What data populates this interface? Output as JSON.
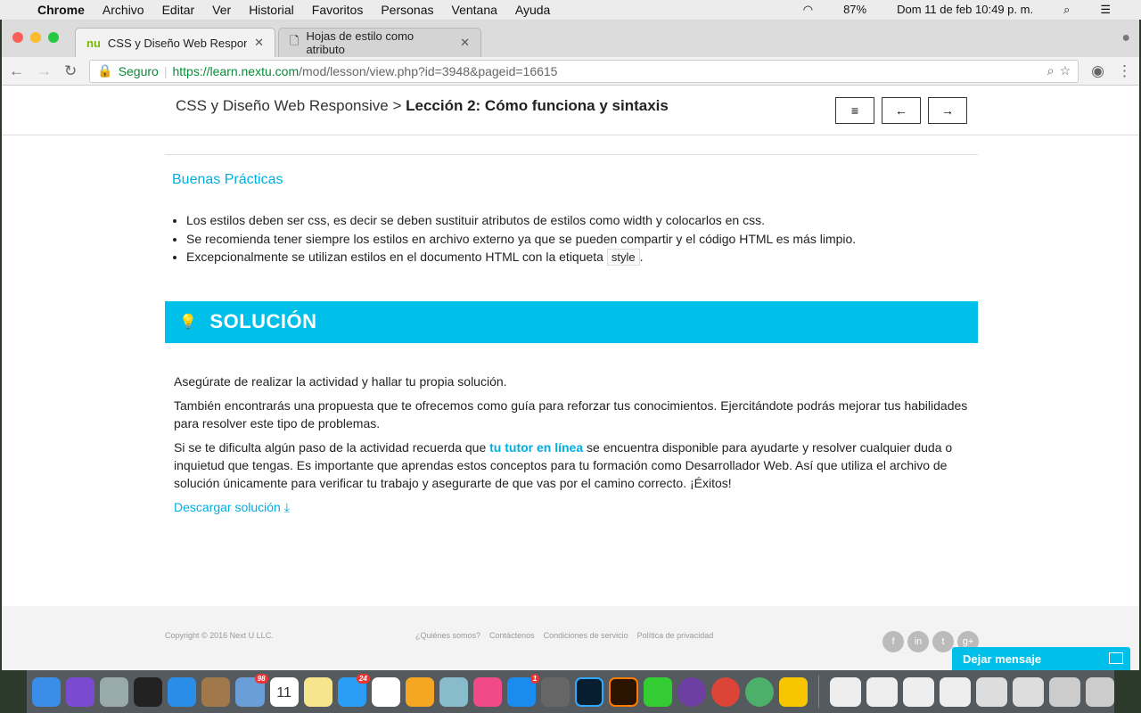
{
  "menubar": {
    "app": "Chrome",
    "items": [
      "Archivo",
      "Editar",
      "Ver",
      "Historial",
      "Favoritos",
      "Personas",
      "Ventana",
      "Ayuda"
    ],
    "battery": "87%",
    "datetime": "Dom 11 de feb  10:49 p. m."
  },
  "tabs": [
    {
      "title": "CSS y Diseño Web Responsive"
    },
    {
      "title": "Hojas de estilo como atributo"
    }
  ],
  "address": {
    "secure_label": "Seguro",
    "url_host": "https://learn.nextu.com",
    "url_path": "/mod/lesson/view.php?id=3948&pageid=16615"
  },
  "header": {
    "course": "CSS y Diseño Web Responsive >",
    "lesson": "Lección 2: Cómo funciona y sintaxis",
    "menu": "≡",
    "prev": "←",
    "next": "→"
  },
  "practices": {
    "title": "Buenas Prácticas",
    "items": [
      {
        "pre": "Los estilos deben ser css, es decir se deben sustituir atributos de estilos como width y colocarlos en css."
      },
      {
        "pre": "Se recomienda tener siempre los estilos en archivo externo ya que se pueden compartir y el código HTML es más limpio."
      },
      {
        "pre": "Excepcionalmente se utilizan estilos en el documento HTML con la etiqueta ",
        "code": "style",
        "post": "."
      }
    ]
  },
  "solution": {
    "title": "SOLUCIÓN",
    "p1": "Asegúrate de realizar la actividad y hallar tu propia solución.",
    "p2": "También encontrarás una propuesta que te ofrecemos como guía para reforzar tus conocimientos. Ejercitándote podrás mejorar tus habilidades para resolver este tipo de problemas.",
    "p3a": "Si se te dificulta algún paso de la actividad recuerda que ",
    "p3link": "tu tutor en línea",
    "p3b": " se encuentra disponible para ayudarte y resolver cualquier duda o inquietud que tengas. Es importante que aprendas estos conceptos para tu formación como Desarrollador Web. Así que utiliza el archivo de solución únicamente para verificar tu trabajo y asegurarte de que vas por el camino correcto. ¡Éxitos!",
    "download": "Descargar solución"
  },
  "footer": {
    "copyright": "Copyright © 2016 Next U LLC.",
    "links": [
      "¿Quiénes somos?",
      "Contáctenos",
      "Condiciones de servicio",
      "Política de privacidad"
    ],
    "social": [
      "f",
      "in",
      "t",
      "g+"
    ]
  },
  "chat": {
    "label": "Dejar mensaje"
  },
  "dock": {
    "badges": [
      "98",
      "24",
      "1"
    ],
    "calendar": "11"
  }
}
